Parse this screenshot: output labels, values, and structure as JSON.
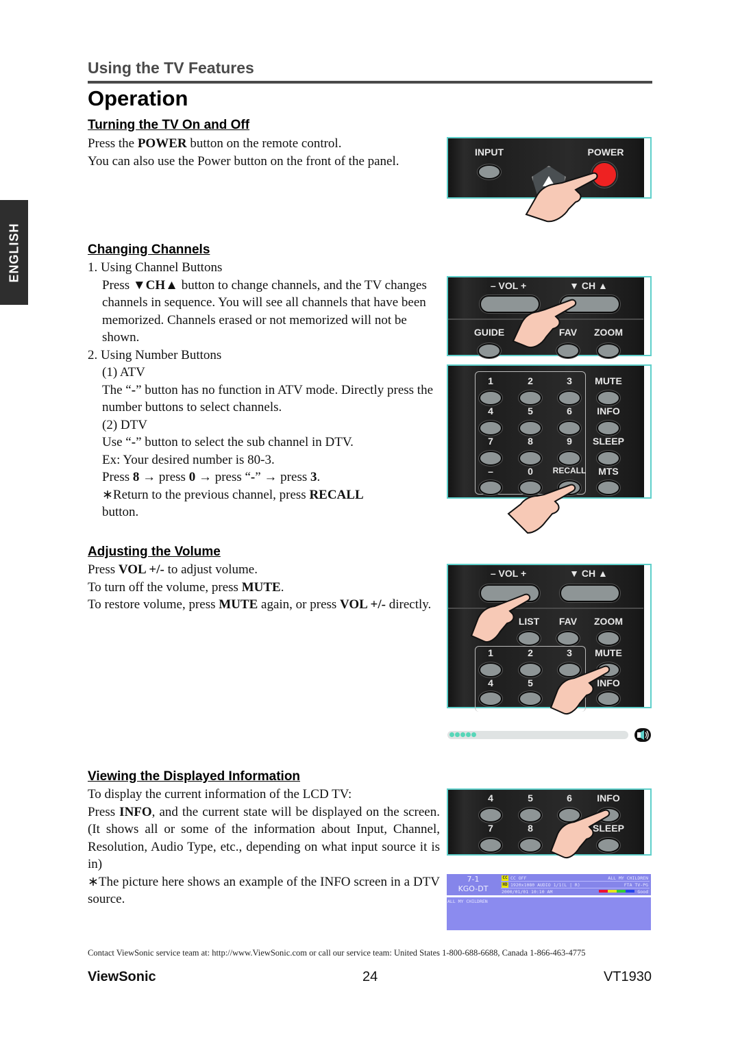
{
  "header": {
    "section": "Using the TV Features",
    "title": "Operation",
    "language_tab": "ENGLISH"
  },
  "sections": {
    "power": {
      "heading": "Turning the TV On and Off",
      "line1_pre": "Press the ",
      "line1_bold": "POWER",
      "line1_post": " button on the remote control.",
      "line2": "You can also use the Power button on the front of the panel."
    },
    "channels": {
      "heading": "Changing Channels",
      "item1": "1. Using Channel Buttons",
      "item1_p_pre": "Press ",
      "item1_p_bold": "▼CH▲",
      "item1_p_post": " button to change channels, and the TV changes channels in sequence. You will see all channels that have been memorized. Channels erased or not memorized will not be shown.",
      "item2": "2. Using Number Buttons",
      "atv_label": "(1) ATV",
      "atv_text_pre": "The “",
      "atv_text_bold": "-",
      "atv_text_post": "” button has no function in ATV mode. Directly press the number buttons to select channels.",
      "dtv_label": "(2) DTV",
      "dtv_text_pre": "Use “",
      "dtv_text_bold": "-",
      "dtv_text_post": "” button to select the sub channel in DTV.",
      "example": "Ex: Your desired number is 80-3.",
      "seq": [
        "Press ",
        "8",
        " → press ",
        "0",
        " → press “",
        "-",
        "” → press ",
        "3",
        "."
      ],
      "recall_pre": "∗Return to the previous channel, press ",
      "recall_bold": "RECALL",
      "recall_post": "button."
    },
    "volume": {
      "heading": "Adjusting the Volume",
      "l1": [
        "Press ",
        "VOL +/-",
        " to adjust volume."
      ],
      "l2": [
        "To turn off the volume, press ",
        "MUTE",
        "."
      ],
      "l3": [
        "To restore volume, press ",
        "MUTE",
        " again, or press ",
        "VOL +/-",
        " directly."
      ]
    },
    "info": {
      "heading": "Viewing the Displayed Information",
      "l1": "To display the current information of the LCD TV:",
      "l2_pre": "Press ",
      "l2_bold": "INFO",
      "l2_post": ", and the current state will be displayed on the screen. (It shows all or some of the information about Input, Channel, Resolution, Audio Type, etc., depending on what input source it is in)",
      "note": "∗The picture here shows an example of the INFO screen in a DTV source."
    }
  },
  "remote_labels": {
    "input": "INPUT",
    "power": "POWER",
    "vol": "–  VOL  +",
    "ch": "▼  CH  ▲",
    "guide": "GUIDE",
    "list": "LIST",
    "fav": "FAV",
    "zoom": "ZOOM",
    "n1": "1",
    "n2": "2",
    "n3": "3",
    "n4": "4",
    "n5": "5",
    "n6": "6",
    "n7": "7",
    "n8": "8",
    "n9": "9",
    "n0": "0",
    "dash": "–",
    "recall": "RECALL",
    "mute": "MUTE",
    "info": "INFO",
    "sleep": "SLEEP",
    "mts": "MTS"
  },
  "volume_indicator": {
    "level_dots": 5,
    "accent": "#57d6b8"
  },
  "info_screen": {
    "channel": "7-1",
    "station": "KGO-DT",
    "cc_tag": "CC",
    "cc_text": "CC OFF",
    "hd_tag": "HD",
    "resolution_audio": "1920x1080   AUDIO  1/1(L | R)",
    "datetime": "2000/01/01  10:10  AM",
    "program_right": "ALL MY CHILDREN",
    "rating": "FTA TV-PG",
    "signal": "Good",
    "program_title": "ALL MY CHILDREN",
    "signal_colors": [
      "#ee1133",
      "#e6e61a",
      "#33cc33",
      "#2244ee"
    ]
  },
  "footer": {
    "contact": "Contact ViewSonic service team at: http://www.ViewSonic.com or call our service team: United States 1-800-688-6688, Canada 1-866-463-4775",
    "brand": "ViewSonic",
    "page": "24",
    "model": "VT1930"
  }
}
